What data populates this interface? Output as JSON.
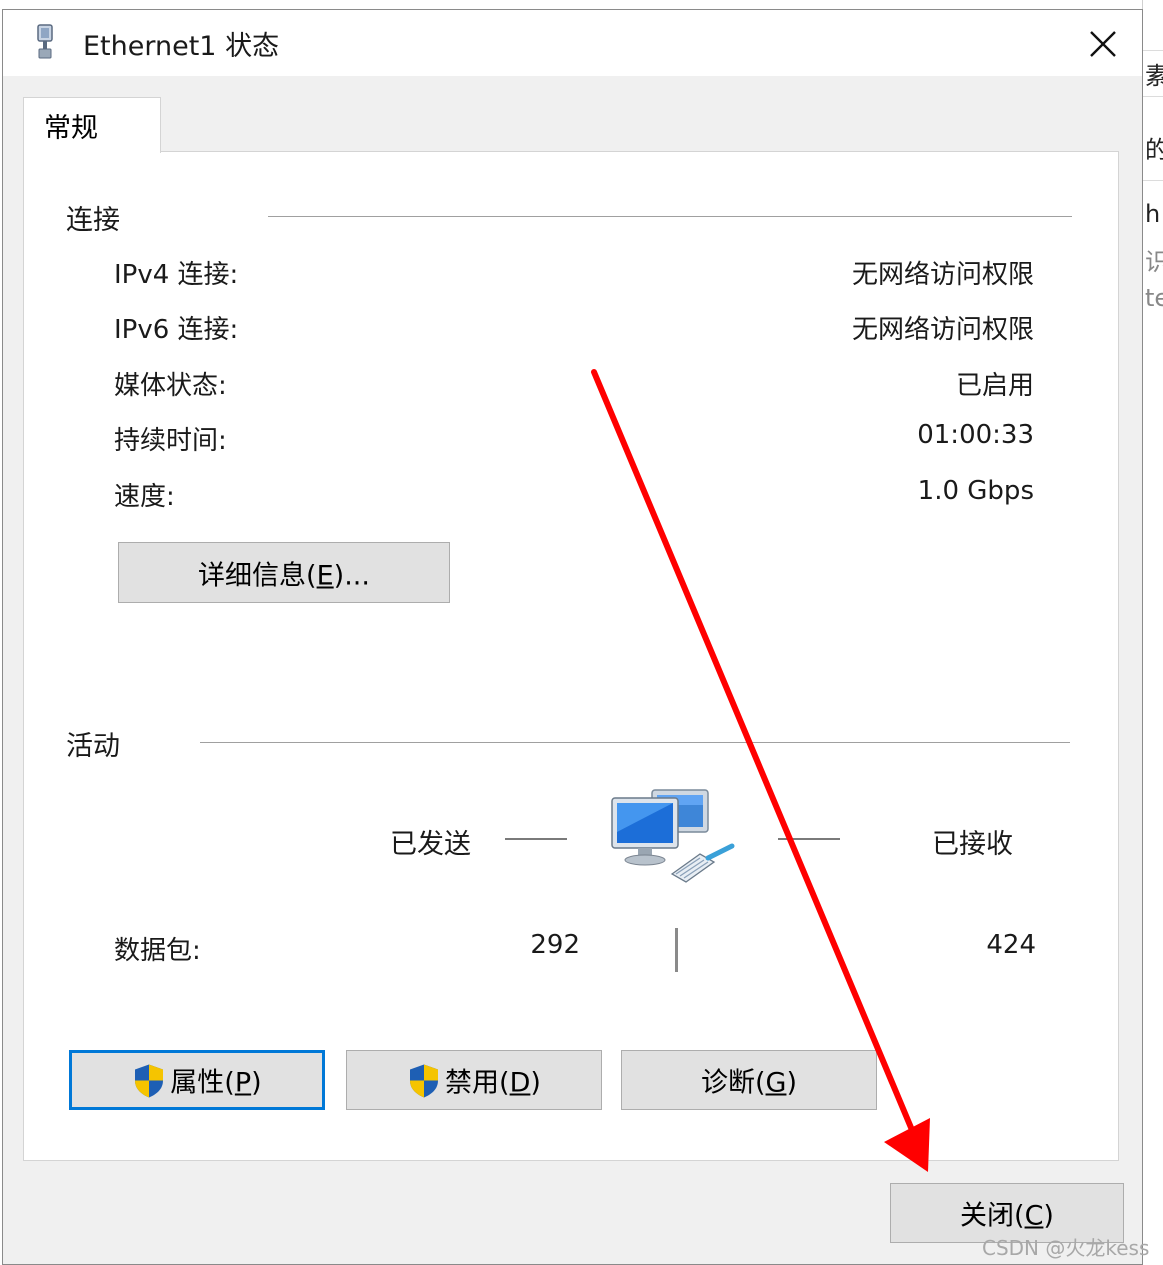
{
  "window": {
    "title": "Ethernet1 状态",
    "close_glyph": "✕"
  },
  "tab": {
    "label": "常规"
  },
  "connection": {
    "section_label": "连接",
    "rows": [
      {
        "label": "IPv4 连接:",
        "value": "无网络访问权限"
      },
      {
        "label": "IPv6 连接:",
        "value": "无网络访问权限"
      },
      {
        "label": "媒体状态:",
        "value": "已启用"
      },
      {
        "label": "持续时间:",
        "value": "01:00:33"
      },
      {
        "label": "速度:",
        "value": "1.0 Gbps"
      }
    ],
    "details_button": {
      "text": "详细信息(",
      "accel": "E",
      "suffix": ")..."
    }
  },
  "activity": {
    "section_label": "活动",
    "sent_label": "已发送",
    "received_label": "已接收",
    "packets_label": "数据包:",
    "packets_sent": "292",
    "packets_received": "424",
    "network_icon": "network-computers-icon"
  },
  "buttons": {
    "properties": {
      "text": "属性(",
      "accel": "P",
      "suffix": ")"
    },
    "disable": {
      "text": "禁用(",
      "accel": "D",
      "suffix": ")"
    },
    "diagnose": {
      "text": "诊断(",
      "accel": "G",
      "suffix": ")"
    },
    "close": {
      "text": "关闭(",
      "accel": "C",
      "suffix": ")"
    }
  },
  "watermark": "CSDN @火龙kess",
  "background_window": {
    "fragments": [
      "素",
      "的",
      "h",
      "识",
      "te"
    ]
  },
  "colors": {
    "accent": "#0078d7",
    "annotation_arrow": "#ff0000",
    "shield_blue": "#1e5fb4",
    "shield_yellow": "#f5c400"
  }
}
